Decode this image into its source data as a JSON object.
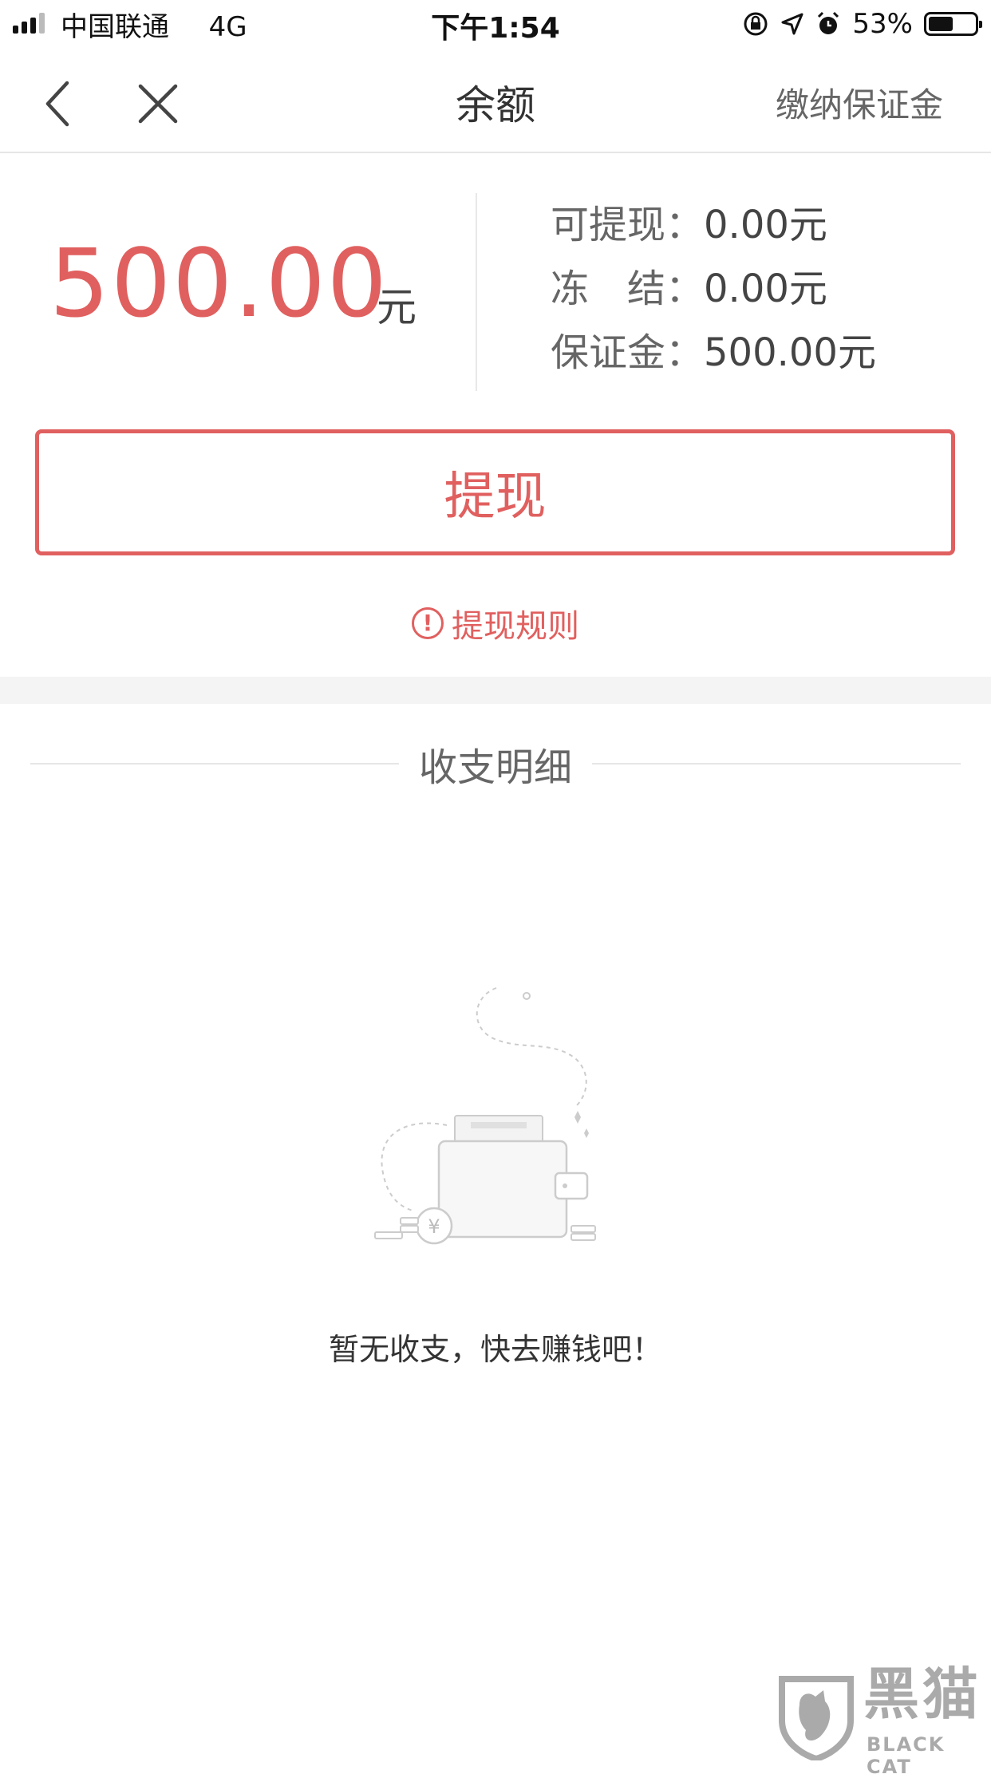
{
  "status_bar": {
    "carrier": "中国联通",
    "network": "4G",
    "time": "下午1:54",
    "battery": "53%",
    "battery_level": 0.53,
    "icons": [
      "signal-icon",
      "orientation-lock-icon",
      "location-icon",
      "alarm-icon",
      "battery-icon"
    ]
  },
  "nav": {
    "title": "余额",
    "action": "缴纳保证金",
    "icons": [
      "back-icon",
      "close-icon"
    ]
  },
  "balance": {
    "amount": "500.00",
    "unit": "元",
    "details": [
      {
        "label": "可提现：",
        "value": "0.00元"
      },
      {
        "label": "冻　结：",
        "value": "0.00元"
      },
      {
        "label": "保证金：",
        "value": "500.00元"
      }
    ]
  },
  "withdraw_button": "提现",
  "rules_link": "提现规则",
  "section_title": "收支明细",
  "empty_state": {
    "text": "暂无收支，快去赚钱吧！",
    "icon": "empty-wallet-icon"
  },
  "watermark": {
    "cn": "黑猫",
    "en": "BLACK CAT"
  },
  "colors": {
    "accent": "#e0605f",
    "text": "#333333",
    "muted": "#666666",
    "divider": "#e6e6e6",
    "band": "#f4f4f4"
  }
}
